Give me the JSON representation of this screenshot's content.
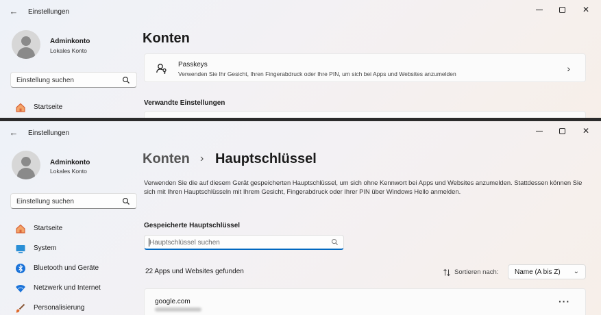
{
  "window": {
    "app_title": "Einstellungen",
    "back_glyph": "←",
    "close_glyph": "✕"
  },
  "user": {
    "name": "Adminkonto",
    "account_type": "Lokales Konto"
  },
  "search": {
    "placeholder": "Einstellung suchen"
  },
  "nav": [
    {
      "label": "Startseite",
      "icon": "home-icon"
    },
    {
      "label": "System",
      "icon": "system-icon"
    },
    {
      "label": "Bluetooth und Geräte",
      "icon": "bluetooth-icon"
    },
    {
      "label": "Netzwerk und Internet",
      "icon": "wifi-icon"
    },
    {
      "label": "Personalisierung",
      "icon": "brush-icon"
    }
  ],
  "top_window": {
    "page_title": "Konten",
    "passkeys_card": {
      "title": "Passkeys",
      "description": "Verwenden Sie Ihr Gesicht, Ihren Fingerabdruck oder Ihre PIN, um sich bei Apps und Websites anzumelden",
      "chevron": "›"
    },
    "related_section": "Verwandte Einstellungen"
  },
  "bottom_window": {
    "breadcrumb_parent": "Konten",
    "breadcrumb_separator": "›",
    "page_title": "Hauptschlüssel",
    "description": "Verwenden Sie die auf diesem Gerät gespeicherten Hauptschlüssel, um sich ohne Kennwort bei Apps und Websites anzumelden. Stattdessen können Sie sich mit Ihren Hauptschlüsseln mit Ihrem Gesicht, Fingerabdruck oder Ihrer PIN über Windows Hello anmelden.",
    "saved_section": "Gespeicherte Hauptschlüssel",
    "key_search_placeholder": "Hauptschlüssel suchen",
    "results_count": "22 Apps und Websites gefunden",
    "sort_label": "Sortieren nach:",
    "sort_value": "Name (A bis Z)",
    "sort_chevron": "⌄",
    "first_site": "google.com",
    "more_glyph": "···"
  },
  "colors": {
    "accent": "#0067c0"
  }
}
